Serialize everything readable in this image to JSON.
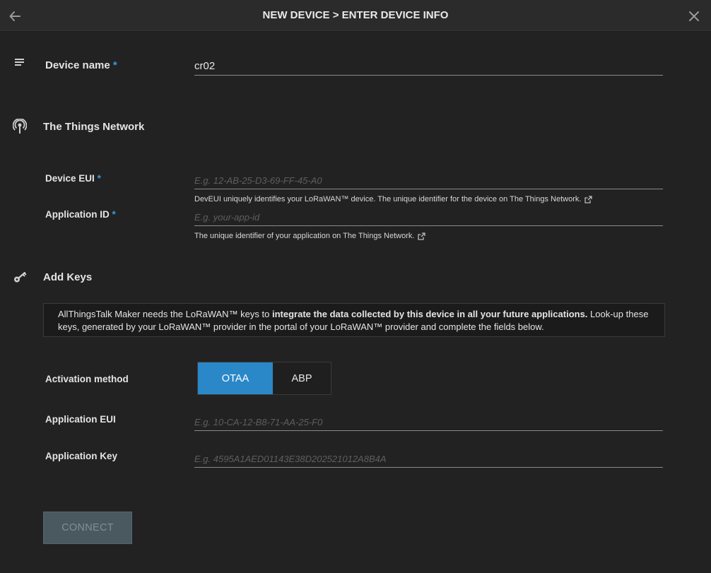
{
  "header": {
    "title": "NEW DEVICE > ENTER DEVICE INFO",
    "back_icon": "arrow-left-icon",
    "close_icon": "close-icon"
  },
  "device_name": {
    "label": "Device name",
    "required_mark": "*",
    "value": "cr02"
  },
  "ttn_section": {
    "title": "The Things Network",
    "icon": "antenna-icon",
    "device_eui": {
      "label": "Device EUI",
      "required_mark": "*",
      "placeholder": "E.g. 12-AB-25-D3-69-FF-45-A0",
      "help": "DevEUI uniquely identifies your LoRaWAN™ device. The unique identifier for the device on The Things Network."
    },
    "application_id": {
      "label": "Application ID",
      "required_mark": "*",
      "placeholder": "E.g. your-app-id",
      "help": "The unique identifier of your application on The Things Network."
    }
  },
  "keys_section": {
    "title": "Add Keys",
    "icon": "key-icon",
    "info_pre": "AllThingsTalk Maker needs the LoRaWAN™ keys to ",
    "info_bold": "integrate the data collected by this device in all your future applications.",
    "info_post": " Look-up these keys, generated by your LoRaWAN™ provider in the portal of your LoRaWAN™ provider and complete the fields below.",
    "activation": {
      "label": "Activation method",
      "options": [
        "OTAA",
        "ABP"
      ],
      "selected": "OTAA"
    },
    "application_eui": {
      "label": "Application EUI",
      "placeholder": "E.g. 10-CA-12-B8-71-AA-25-F0"
    },
    "application_key": {
      "label": "Application Key",
      "placeholder": "E.g. 4595A1AED01143E38D202521012A8B4A"
    }
  },
  "connect_label": "CONNECT",
  "colors": {
    "accent": "#2a88c8",
    "required": "#3a9ad9",
    "background": "#222222"
  }
}
